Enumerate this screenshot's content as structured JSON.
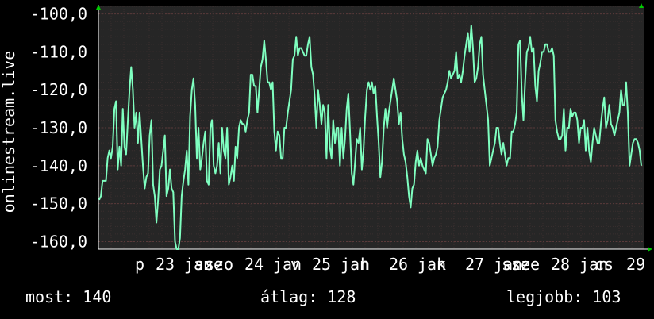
{
  "chart_data": {
    "type": "line",
    "ylabel": "onlinestream.live",
    "ylim": [
      -162,
      -98
    ],
    "y_ticks": [
      "-100,0",
      "-110,0",
      "-120,0",
      "-130,0",
      "-140,0",
      "-150,0",
      "-160,0"
    ],
    "x_ticks": [
      "p",
      "23",
      "jan",
      "sze",
      "szo",
      "24",
      "jan",
      "v",
      "25",
      "jan",
      "h",
      "26",
      "jan",
      "k",
      "27",
      "jan",
      "sze",
      "sze",
      "28",
      "jan",
      "cs",
      "29"
    ],
    "grid": true,
    "colors": {
      "background": "#000000",
      "plot_bg": "#262626",
      "line": "#7fffc0",
      "grid": "#5a3a3a",
      "axis_arrow": "#00cc00"
    },
    "values": [
      -149,
      -148,
      -144,
      -144,
      -144,
      -138,
      -136,
      -138,
      -135,
      -125,
      -123,
      -141,
      -135,
      -140,
      -125,
      -135,
      -137,
      -128,
      -120,
      -114,
      -120,
      -130,
      -126,
      -134,
      -126,
      -133,
      -140,
      -146,
      -143,
      -142,
      -132,
      -128,
      -145,
      -148,
      -155,
      -149,
      -141,
      -140,
      -136,
      -132,
      -148,
      -146,
      -141,
      -146,
      -147,
      -160,
      -162,
      -162,
      -159,
      -148,
      -144,
      -141,
      -136,
      -145,
      -127,
      -120,
      -117,
      -124,
      -138,
      -130,
      -141,
      -138,
      -134,
      -131,
      -144,
      -145,
      -130,
      -128,
      -140,
      -142,
      -140,
      -134,
      -142,
      -130,
      -136,
      -138,
      -130,
      -145,
      -143,
      -140,
      -144,
      -135,
      -138,
      -130,
      -128,
      -129,
      -129,
      -131,
      -128,
      -126,
      -116,
      -116,
      -119,
      -119,
      -126,
      -120,
      -114,
      -112,
      -107,
      -112,
      -118,
      -118,
      -120,
      -118,
      -131,
      -136,
      -131,
      -132,
      -138,
      -138,
      -130,
      -130,
      -126,
      -123,
      -120,
      -112,
      -111,
      -106,
      -111,
      -109,
      -109,
      -110,
      -111,
      -111,
      -108,
      -106,
      -114,
      -116,
      -122,
      -130,
      -120,
      -124,
      -129,
      -124,
      -126,
      -138,
      -124,
      -135,
      -138,
      -128,
      -134,
      -130,
      -130,
      -140,
      -130,
      -138,
      -133,
      -125,
      -121,
      -131,
      -142,
      -145,
      -139,
      -133,
      -134,
      -130,
      -141,
      -136,
      -127,
      -120,
      -118,
      -120,
      -118,
      -121,
      -119,
      -127,
      -134,
      -143,
      -139,
      -130,
      -125,
      -130,
      -126,
      -123,
      -120,
      -117,
      -120,
      -123,
      -129,
      -126,
      -133,
      -137,
      -139,
      -143,
      -148,
      -151,
      -146,
      -145,
      -139,
      -136,
      -140,
      -138,
      -140,
      -141,
      -142,
      -133,
      -134,
      -137,
      -140,
      -138,
      -137,
      -135,
      -128,
      -125,
      -122,
      -121,
      -120,
      -118,
      -115,
      -117,
      -116,
      -115,
      -110,
      -117,
      -116,
      -118,
      -115,
      -111,
      -108,
      -105,
      -110,
      -103,
      -109,
      -118,
      -117,
      -114,
      -108,
      -106,
      -116,
      -120,
      -124,
      -128,
      -140,
      -138,
      -136,
      -134,
      -130,
      -130,
      -134,
      -137,
      -134,
      -137,
      -140,
      -138,
      -138,
      -131,
      -131,
      -129,
      -126,
      -108,
      -107,
      -121,
      -128,
      -118,
      -110,
      -109,
      -106,
      -110,
      -109,
      -119,
      -123,
      -115,
      -113,
      -110,
      -110,
      -108,
      -108,
      -110,
      -110,
      -109,
      -111,
      -128,
      -131,
      -133,
      -133,
      -132,
      -125,
      -136,
      -130,
      -130,
      -125,
      -127,
      -126,
      -126,
      -128,
      -134,
      -130,
      -130,
      -128,
      -136,
      -130,
      -136,
      -139,
      -134,
      -130,
      -132,
      -134,
      -134,
      -129,
      -125,
      -122,
      -130,
      -128,
      -124,
      -129,
      -130,
      -132,
      -130,
      -128,
      -126,
      -120,
      -124,
      -124,
      -118,
      -126,
      -140,
      -137,
      -134,
      -133,
      -133,
      -134,
      -136,
      -140
    ]
  },
  "stats": {
    "current": "most: 140",
    "average": "átlag: 128",
    "best": "legjobb: 103"
  }
}
